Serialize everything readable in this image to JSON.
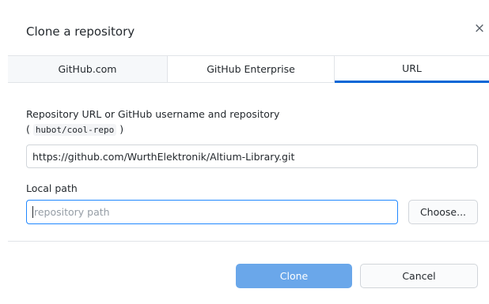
{
  "dialog": {
    "title": "Clone a repository",
    "close_icon": "×"
  },
  "tabs": [
    {
      "label": "GitHub.com",
      "selected": false
    },
    {
      "label": "GitHub Enterprise",
      "selected": false
    },
    {
      "label": "URL",
      "selected": true
    }
  ],
  "url_section": {
    "label": "Repository URL or GitHub username and repository",
    "hint_open": "(",
    "hint_code": "hubot/cool-repo",
    "hint_close": ")",
    "value": "https://github.com/WurthElektronik/Altium-Library.git"
  },
  "path_section": {
    "label": "Local path",
    "placeholder": "repository path",
    "choose_label": "Choose..."
  },
  "actions": {
    "clone_label": "Clone",
    "cancel_label": "Cancel"
  },
  "colors": {
    "accent": "#0366d6",
    "focus": "#2188ff",
    "clone_button": "#6aa7ea"
  }
}
